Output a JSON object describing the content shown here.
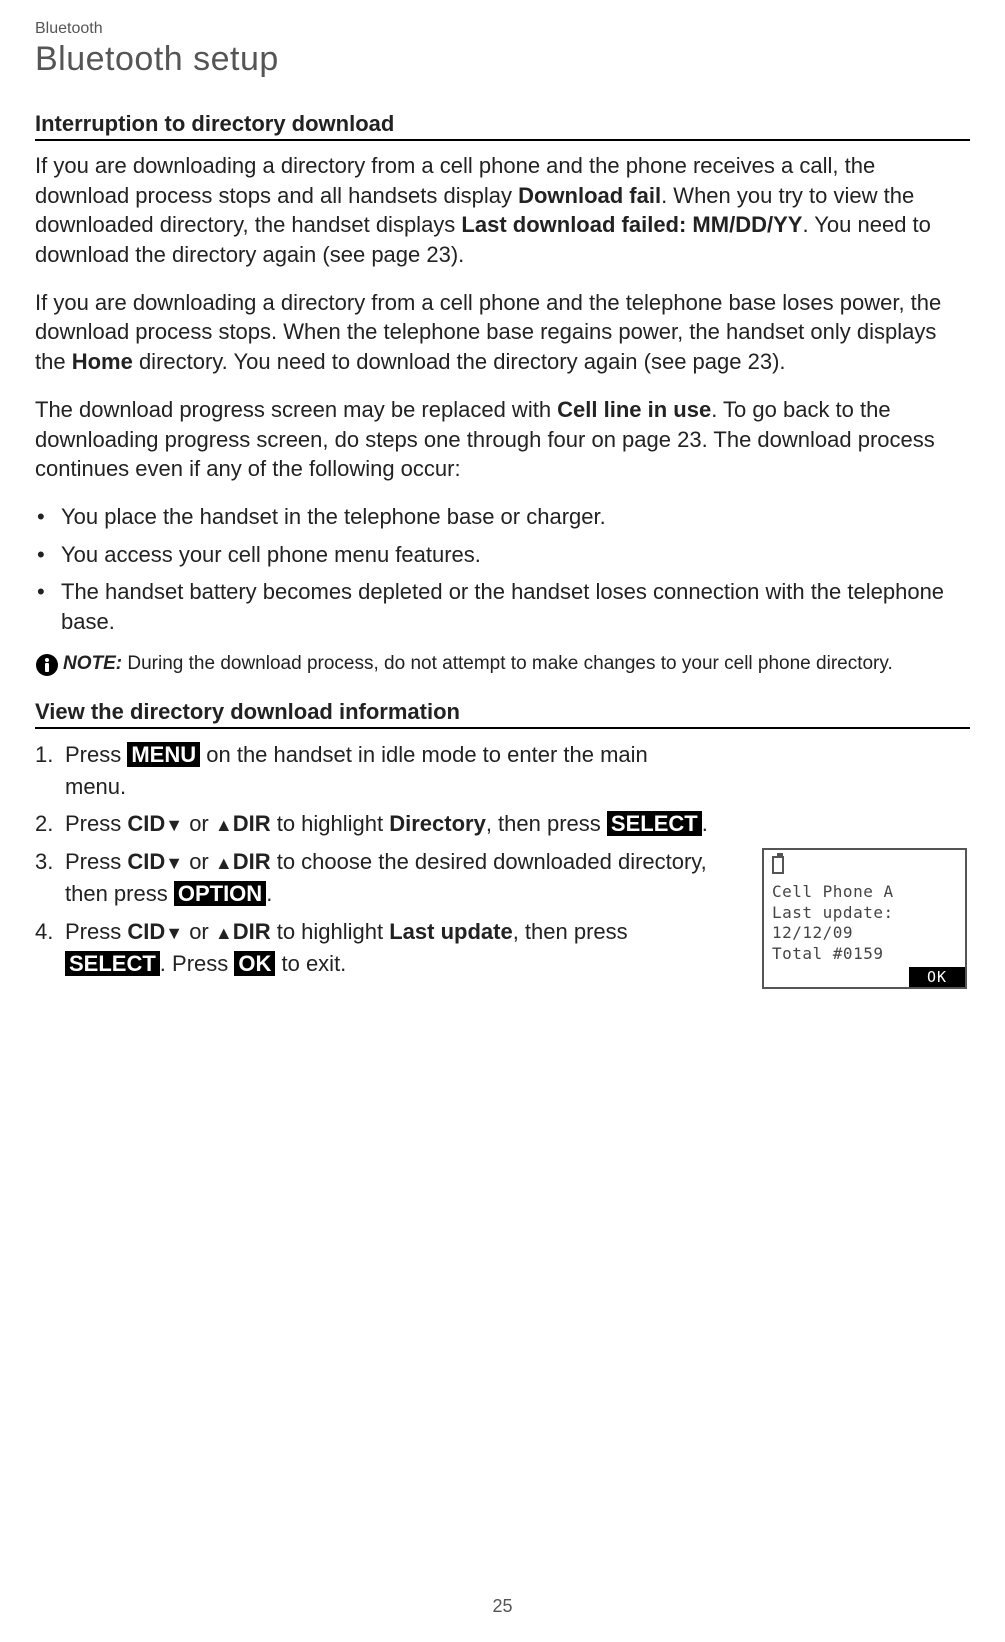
{
  "breadcrumb": "Bluetooth",
  "title": "Bluetooth setup",
  "section1": {
    "heading": "Interruption to directory download",
    "p1_pre": "If you are downloading a directory from a cell phone and the phone receives a call, the download process stops and all handsets display ",
    "p1_b1": "Download fail",
    "p1_mid": ". When you try to view the downloaded directory, the handset displays ",
    "p1_b2": "Last download failed: MM/DD/YY",
    "p1_post": ". You need to download the directory again (see page 23).",
    "p2_pre": "If you are downloading a directory from a cell phone and the telephone base loses power, the download process stops. When the telephone base regains power, the handset only displays the ",
    "p2_b1": "Home",
    "p2_post": " directory. You need to download the directory again (see page 23).",
    "p3_pre": "The download progress screen may be replaced with ",
    "p3_b1": "Cell line in use",
    "p3_post": ". To go back to the downloading progress screen, do steps one through four on page 23. The download process continues even if any of the following occur:",
    "bullets": [
      "You place the handset in the telephone base or charger.",
      "You access your cell phone menu features.",
      "The handset battery becomes depleted or the handset loses connection with the telephone base."
    ],
    "note_label": "NOTE:",
    "note_text": " During the download process, do not attempt to make changes to your cell phone directory."
  },
  "section2": {
    "heading": "View the directory download information",
    "step1_pre": "Press ",
    "menu_key": "MENU",
    "step1_post": " on the handset in idle mode to enter the main menu.",
    "step2_pre": "Press ",
    "cid_label": "CID",
    "or_text": " or ",
    "dir_label": "DIR",
    "step2_mid": " to highlight ",
    "directory_label": "Directory",
    "step2_then": ", then press ",
    "select_key": "SELECT",
    "period": ".",
    "step3_mid": " to choose the desired downloaded directory, then press ",
    "option_key": "OPTION",
    "step4_mid": " to highlight ",
    "last_update_label": "Last update",
    "step4_then": ", then press ",
    "step4_press": ". Press ",
    "ok_key": "OK",
    "step4_exit": " to exit."
  },
  "screen": {
    "line1": "Cell Phone A",
    "line2": "Last update:",
    "line3": "12/12/09",
    "line4": "Total #0159",
    "softkey": "OK"
  },
  "page_number": "25"
}
